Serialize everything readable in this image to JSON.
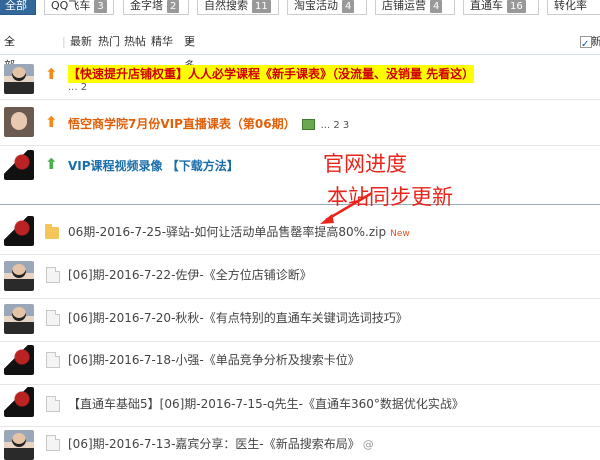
{
  "tabs": [
    {
      "label": "全部",
      "count": "",
      "active": true
    },
    {
      "label": "QQ飞车",
      "count": "3",
      "active": false
    },
    {
      "label": "金字塔",
      "count": "2",
      "active": false
    },
    {
      "label": "自然搜索",
      "count": "11",
      "active": false
    },
    {
      "label": "淘宝活动",
      "count": "4",
      "active": false
    },
    {
      "label": "店铺运营",
      "count": "4",
      "active": false
    },
    {
      "label": "直通车",
      "count": "16",
      "active": false
    },
    {
      "label": "转化率",
      "count": "",
      "active": false
    }
  ],
  "filter": {
    "all_topics": "全部主题",
    "latest": "最新",
    "hot": "热门",
    "hot_posts": "热帖",
    "essence": "精华",
    "more": "更多",
    "new_window": "新"
  },
  "threads": [
    {
      "title": "【快速提升店铺权重】人人必学课程《新手课表》（没流量、没销量 先看这）",
      "pages": "... 2"
    },
    {
      "title": "悟空商学院7月份VIP直播课表（第06期）",
      "pages": "... 2 3"
    },
    {
      "title": "VIP课程视频录像 【下载方法】"
    },
    {
      "title": "06期-2016-7-25-驿站-如何让活动单品售罄率提高80%.zip",
      "tag": "New"
    },
    {
      "title": "[06]期-2016-7-22-佐伊-《全方位店铺诊断》"
    },
    {
      "title": "[06]期-2016-7-20-秋秋-《有点特别的直通车关键词选词技巧》"
    },
    {
      "title": "[06]期-2016-7-18-小强-《单品竞争分析及搜索卡位》"
    },
    {
      "title": "【直通车基础5】[06]期-2016-7-15-q先生-《直通车360°数据优化实战》"
    },
    {
      "title": "[06]期-2016-7-13-嘉宾分享：医生-《新品搜索布局》"
    }
  ],
  "annotation": {
    "line1": "官网进度",
    "line2": "本站同步更新"
  },
  "colors": {
    "accent": "#336699",
    "highlight": "#ffff00",
    "annotation": "#e8241b"
  }
}
